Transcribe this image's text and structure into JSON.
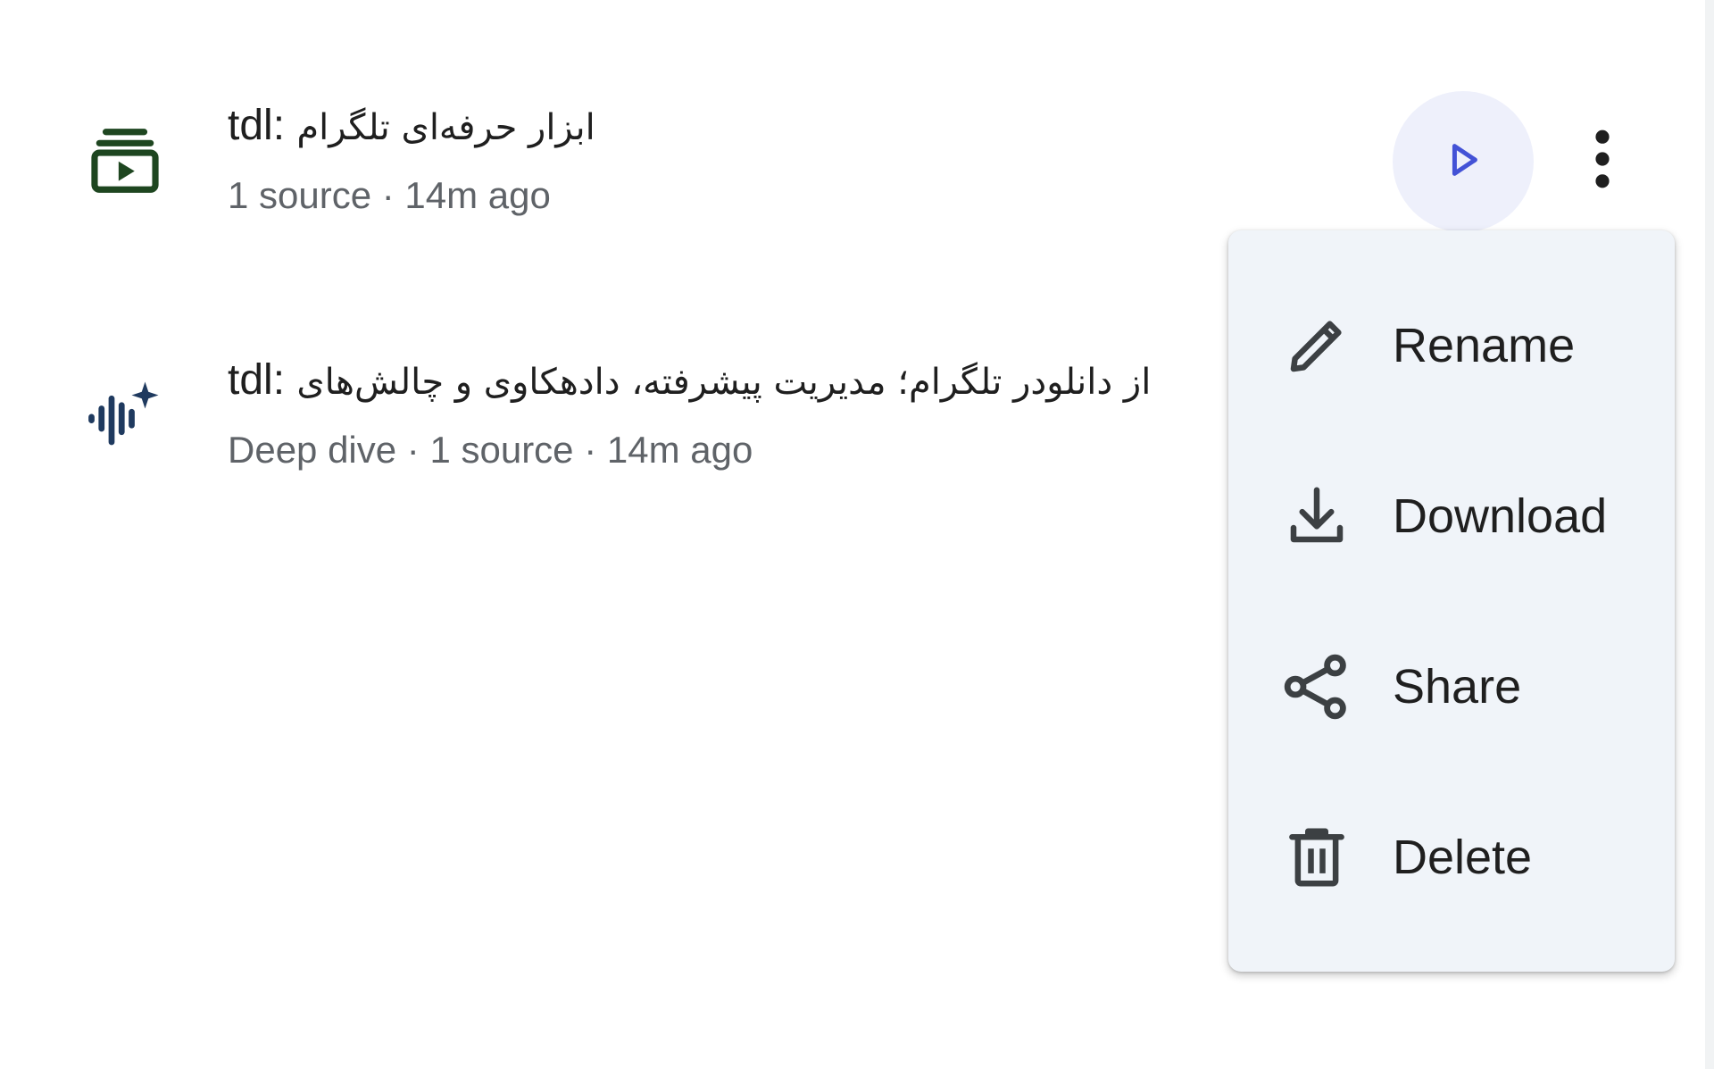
{
  "notes": [
    {
      "title_prefix": "tdl: ",
      "title_fa": "ابزار حرفه‌ای تلگرام",
      "meta": "1 source · 14m ago",
      "icon": "video-overview-icon"
    },
    {
      "title_prefix": "tdl: ",
      "title_fa": "از دانلودر تلگرام؛ مدیریت پیشرفته، دادهکاوی و چالش‌های",
      "meta": "Deep dive · 1 source · 14m ago",
      "icon": "audio-sparkle-icon"
    }
  ],
  "controls": {
    "play_icon": "play-icon",
    "more_icon": "more-vert-icon"
  },
  "menu": {
    "items": [
      {
        "label": "Rename",
        "icon": "pencil-icon"
      },
      {
        "label": "Download",
        "icon": "download-icon"
      },
      {
        "label": "Share",
        "icon": "share-icon"
      },
      {
        "label": "Delete",
        "icon": "trash-icon"
      }
    ]
  },
  "colors": {
    "video_icon": "#1e4620",
    "audio_icon": "#1f3a5f",
    "play_accent": "#4352d6",
    "play_bg": "#eef0fb",
    "menu_bg": "#f0f4f9",
    "meta_text": "#5f6368"
  }
}
